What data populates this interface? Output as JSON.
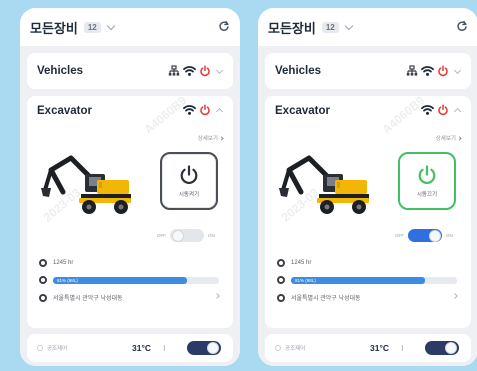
{
  "screens": [
    {
      "header": {
        "title": "모든장비",
        "count": "12"
      },
      "vehicles": {
        "title": "Vehicles"
      },
      "equipment": {
        "title": "Excavator",
        "detail_link": "상세보기",
        "start_button": "시동켜기",
        "toggle_off": "OFF",
        "toggle_on": "ON",
        "toggle_state": "off",
        "hours": "1245 hr",
        "fuel_text": "81% (98L)",
        "fuel_level": 0.81,
        "location": "서울특별시 관악구 낙성대동"
      },
      "climate": {
        "label": "공조제어",
        "temperature": "31°C",
        "arrows": "⁝"
      }
    },
    {
      "header": {
        "title": "모든장비",
        "count": "12"
      },
      "vehicles": {
        "title": "Vehicles"
      },
      "equipment": {
        "title": "Excavator",
        "detail_link": "상세보기",
        "start_button": "시동끄기",
        "toggle_off": "OFF",
        "toggle_on": "ON",
        "toggle_state": "on",
        "hours": "1245 hr",
        "fuel_text": "81% (98L)",
        "fuel_level": 0.81,
        "location": "서울특별시 관악구 낙성대동"
      },
      "climate": {
        "label": "공조제어",
        "temperature": "31°C",
        "arrows": "⁝"
      }
    }
  ],
  "colors": {
    "background": "#a9daf1",
    "power_red": "#e53935",
    "power_green": "#43c063",
    "fuel_blue": "#3c8de2",
    "toggle_on": "#2f6fe0",
    "climate_toggle": "#2b3a67"
  },
  "icons": [
    "refresh-icon",
    "network-icon",
    "wifi-icon",
    "power-icon",
    "chevron-down-icon",
    "chevron-up-icon",
    "excavator-image"
  ]
}
